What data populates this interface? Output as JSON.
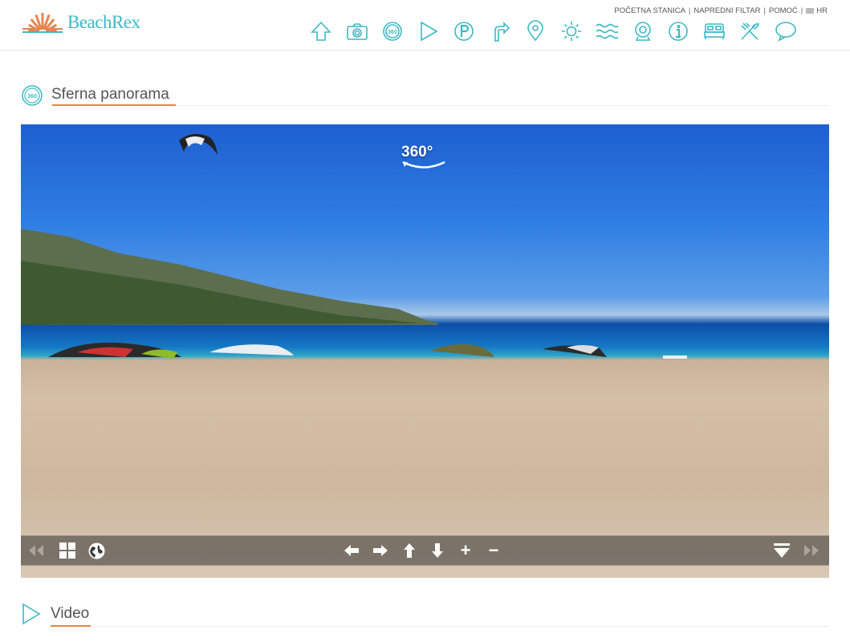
{
  "header": {
    "logo_text": "BeachRex",
    "links": [
      "POČETNA STANICA",
      "NAPREDNI FILTAR",
      "POMOĆ"
    ],
    "language": "HR",
    "accent_color": "#3cb9c6",
    "icons": [
      "arrow-up-icon",
      "camera-icon",
      "360-icon",
      "play-icon",
      "parking-icon",
      "directions-icon",
      "location-pin-icon",
      "sun-icon",
      "waves-icon",
      "webcam-icon",
      "info-icon",
      "bed-icon",
      "restaurant-icon",
      "chat-icon"
    ]
  },
  "panorama_section": {
    "title": "Sferna panorama",
    "badge": "360°"
  },
  "viewer_controls": {
    "left": [
      "rewind-icon",
      "grid-icon",
      "globe-icon"
    ],
    "center": [
      "arrow-left-icon",
      "arrow-right-icon",
      "arrow-up-icon",
      "arrow-down-icon",
      "zoom-in-icon",
      "zoom-out-icon"
    ],
    "right": [
      "hide-controls-icon",
      "forward-icon"
    ],
    "zoom_in_label": "+",
    "zoom_out_label": "−"
  },
  "video_section": {
    "title": "Video"
  },
  "underline_color": "#e8834d"
}
